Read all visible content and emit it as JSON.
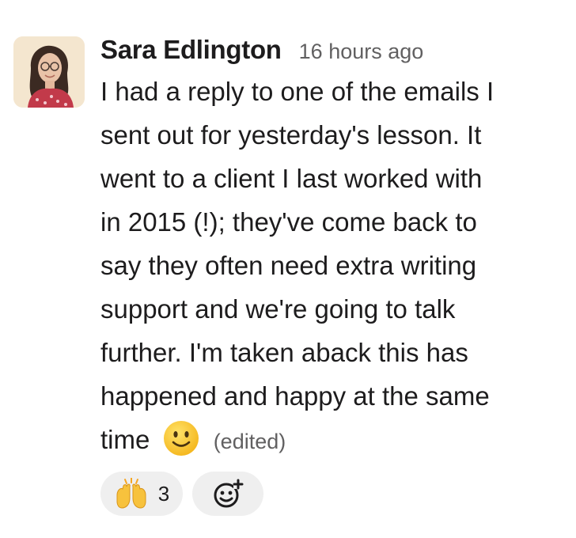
{
  "message": {
    "author": "Sara Edlington",
    "timestamp": "16 hours ago",
    "body_lines": [
      "I had a reply to one of the emails I",
      "sent out for yesterday's lesson. It",
      "went to a client I last worked with",
      "in 2015 (!); they've come back to",
      "say they often need extra writing",
      "support and we're going to talk",
      "further. I'm taken aback this has",
      "happened and happy at the same"
    ],
    "last_line_text": "time",
    "inline_emoji": "slightly-smiling-face",
    "edited_label": "(edited)"
  },
  "reactions": [
    {
      "emoji": "raised-hands",
      "count": "3"
    }
  ],
  "add_reaction_icon": "add-reaction-icon",
  "colors": {
    "text": "#1d1c1d",
    "muted": "#616061",
    "pill_bg": "#efefef"
  }
}
